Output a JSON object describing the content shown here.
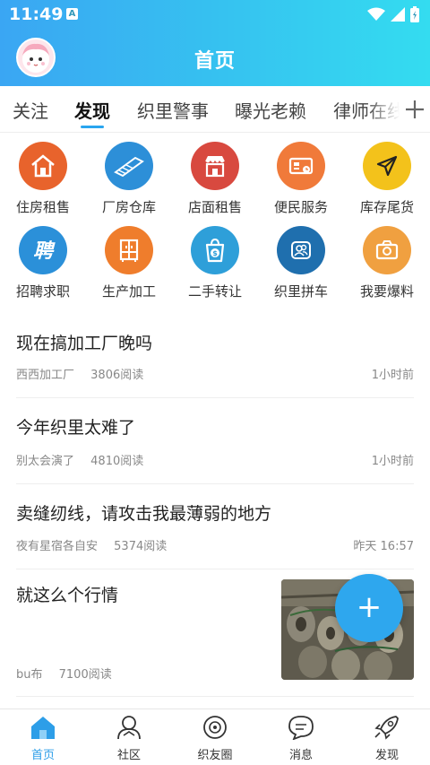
{
  "status_bar": {
    "time": "11:49",
    "notification_icon": "A"
  },
  "header": {
    "title": "首页"
  },
  "tabs": [
    {
      "label": "关注"
    },
    {
      "label": "发现"
    },
    {
      "label": "织里警事"
    },
    {
      "label": "曝光老赖"
    },
    {
      "label": "律师在线"
    }
  ],
  "categories": [
    {
      "label": "住房租售",
      "icon": "house-icon",
      "color": "#e8632c"
    },
    {
      "label": "厂房仓库",
      "icon": "warehouse-icon",
      "color": "#2d8fd8"
    },
    {
      "label": "店面租售",
      "icon": "storefront-icon",
      "color": "#d8493f"
    },
    {
      "label": "便民服务",
      "icon": "service-card-icon",
      "color": "#f07a3a"
    },
    {
      "label": "库存尾货",
      "icon": "send-arrow-icon",
      "color": "#f3c21b"
    },
    {
      "label": "招聘求职",
      "icon": "recruit-icon",
      "color": "#2b90d9"
    },
    {
      "label": "生产加工",
      "icon": "wardrobe-icon",
      "color": "#ef7d2c"
    },
    {
      "label": "二手转让",
      "icon": "shopping-bag-icon",
      "color": "#2e9fd9"
    },
    {
      "label": "织里拼车",
      "icon": "carpool-icon",
      "color": "#1f6fae"
    },
    {
      "label": "我要爆料",
      "icon": "camera-icon",
      "color": "#f0a040"
    }
  ],
  "posts": [
    {
      "title": "现在搞加工厂晚吗",
      "author": "西西加工厂",
      "reads": "3806阅读",
      "time": "1小时前"
    },
    {
      "title": "今年织里太难了",
      "author": "别太会演了",
      "reads": "4810阅读",
      "time": "1小时前"
    },
    {
      "title": "卖缝纫线，请攻击我最薄弱的地方",
      "author": "夜有星宿各自安",
      "reads": "5374阅读",
      "time": "昨天 16:57"
    },
    {
      "title": "就这么个行情",
      "author": "bu布",
      "reads": "7100阅读",
      "time": ""
    }
  ],
  "fab": {
    "label": "+"
  },
  "bottom_nav": [
    {
      "label": "首页",
      "icon": "home-icon"
    },
    {
      "label": "社区",
      "icon": "community-icon"
    },
    {
      "label": "织友圈",
      "icon": "circle-icon"
    },
    {
      "label": "消息",
      "icon": "message-icon"
    },
    {
      "label": "发现",
      "icon": "rocket-icon"
    }
  ],
  "colors": {
    "accent": "#2ea7ee",
    "header_start": "#3aa6f3",
    "header_end": "#34dcf0"
  }
}
